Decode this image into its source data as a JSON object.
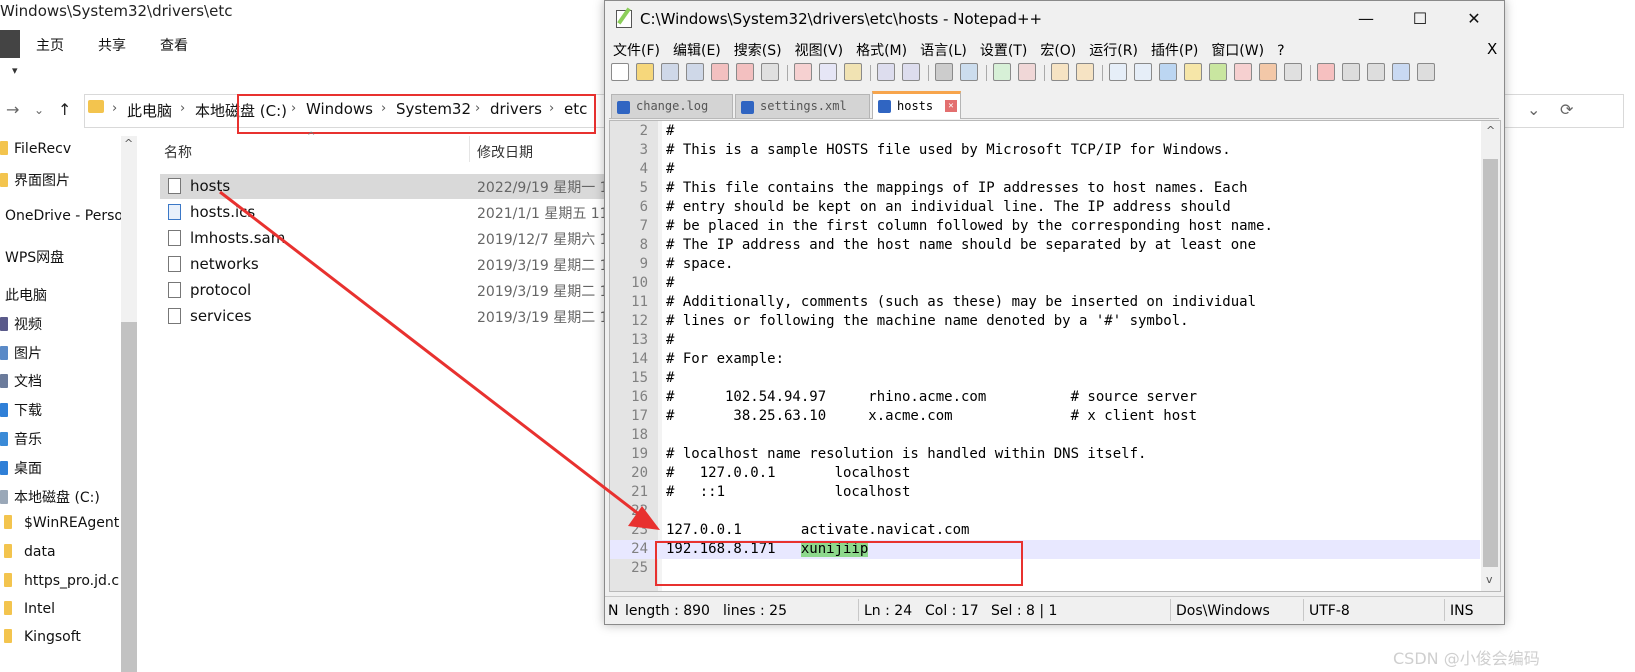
{
  "explorer": {
    "title": "Windows\\System32\\drivers\\etc",
    "ribbon_tabs": [
      "主页",
      "共享",
      "查看"
    ],
    "breadcrumbs": [
      "此电脑",
      "本地磁盘 (C:)",
      "Windows",
      "System32",
      "drivers",
      "etc"
    ],
    "columns": {
      "name": "名称",
      "modified": "修改日期"
    },
    "files": [
      {
        "name": "hosts",
        "date": "2022/9/19 星期一 1"
      },
      {
        "name": "hosts.ics",
        "date": "2021/1/1 星期五 11"
      },
      {
        "name": "lmhosts.sam",
        "date": "2019/12/7 星期六 1"
      },
      {
        "name": "networks",
        "date": "2019/3/19 星期二 1"
      },
      {
        "name": "protocol",
        "date": "2019/3/19 星期二 1"
      },
      {
        "name": "services",
        "date": "2019/3/19 星期二 1"
      }
    ],
    "sidebar": [
      {
        "label": "FileRecv",
        "color": "#f3c44e"
      },
      {
        "label": "界面图片",
        "color": "#f3c44e"
      },
      {
        "label": "OneDrive - Perso",
        "color": ""
      },
      {
        "label": "WPS网盘",
        "color": ""
      },
      {
        "label": "此电脑",
        "color": ""
      },
      {
        "label": "视频",
        "color": "#5a5a8a"
      },
      {
        "label": "图片",
        "color": "#5a8ac7"
      },
      {
        "label": "文档",
        "color": "#6b7b9b"
      },
      {
        "label": "下载",
        "color": "#2f7fd7"
      },
      {
        "label": "音乐",
        "color": "#3a8ad7"
      },
      {
        "label": "桌面",
        "color": "#2f7fd7"
      },
      {
        "label": "本地磁盘 (C:)",
        "color": "#9aa8b8"
      },
      {
        "label": "$WinREAgent",
        "color": "#f3c44e"
      },
      {
        "label": "data",
        "color": "#f3c44e"
      },
      {
        "label": "https_pro.jd.c",
        "color": "#f3c44e"
      },
      {
        "label": "Intel",
        "color": "#f3c44e"
      },
      {
        "label": "Kingsoft",
        "color": "#f3c44e"
      }
    ]
  },
  "npp": {
    "title": "C:\\Windows\\System32\\drivers\\etc\\hosts - Notepad++",
    "menu": [
      "文件(F)",
      "编辑(E)",
      "搜索(S)",
      "视图(V)",
      "格式(M)",
      "语言(L)",
      "设置(T)",
      "宏(O)",
      "运行(R)",
      "插件(P)",
      "窗口(W)",
      "?"
    ],
    "menu_close": "X",
    "tabs": [
      {
        "label": "change.log",
        "active": false
      },
      {
        "label": "settings.xml",
        "active": false
      },
      {
        "label": "hosts",
        "active": true
      }
    ],
    "lines": [
      {
        "n": "2",
        "text": "#"
      },
      {
        "n": "3",
        "text": "# This is a sample HOSTS file used by Microsoft TCP/IP for Windows."
      },
      {
        "n": "4",
        "text": "#"
      },
      {
        "n": "5",
        "text": "# This file contains the mappings of IP addresses to host names. Each"
      },
      {
        "n": "6",
        "text": "# entry should be kept on an individual line. The IP address should"
      },
      {
        "n": "7",
        "text": "# be placed in the first column followed by the corresponding host name."
      },
      {
        "n": "8",
        "text": "# The IP address and the host name should be separated by at least one"
      },
      {
        "n": "9",
        "text": "# space."
      },
      {
        "n": "10",
        "text": "#"
      },
      {
        "n": "11",
        "text": "# Additionally, comments (such as these) may be inserted on individual"
      },
      {
        "n": "12",
        "text": "# lines or following the machine name denoted by a '#' symbol."
      },
      {
        "n": "13",
        "text": "#"
      },
      {
        "n": "14",
        "text": "# For example:"
      },
      {
        "n": "15",
        "text": "#"
      },
      {
        "n": "16",
        "text": "#      102.54.94.97     rhino.acme.com          # source server"
      },
      {
        "n": "17",
        "text": "#       38.25.63.10     x.acme.com              # x client host"
      },
      {
        "n": "18",
        "text": ""
      },
      {
        "n": "19",
        "text": "# localhost name resolution is handled within DNS itself."
      },
      {
        "n": "20",
        "text": "#   127.0.0.1       localhost"
      },
      {
        "n": "21",
        "text": "#   ::1             localhost"
      },
      {
        "n": "22",
        "text": ""
      },
      {
        "n": "23",
        "text": "127.0.0.1       activate.navicat.com"
      },
      {
        "n": "24",
        "text": "192.168.8.171   ",
        "highlight": "xunijiip"
      },
      {
        "n": "25",
        "text": ""
      }
    ],
    "status": {
      "mode": "N",
      "length": "length : 890",
      "lines": "lines : 25",
      "ln": "Ln : 24",
      "col": "Col : 17",
      "sel": "Sel : 8 | 1",
      "eol": "Dos\\Windows",
      "encoding": "UTF-8",
      "ins": "INS"
    }
  },
  "watermark": "CSDN @小俊会编码",
  "colors": {
    "annotation_red": "#e8312f",
    "selection_highlight": "#8dd88c",
    "current_line": "#e8e8ff"
  }
}
